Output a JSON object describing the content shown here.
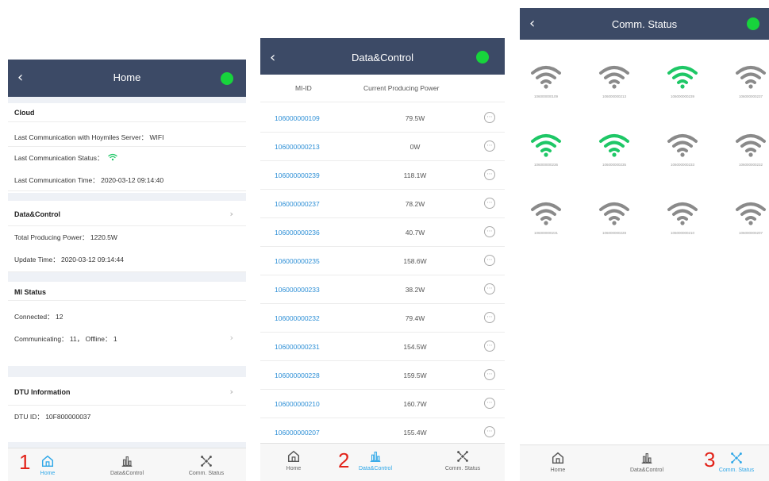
{
  "colors": {
    "navbar": "#3c4a66",
    "status_dot": "#17d43c",
    "link": "#2d8fd6",
    "active_tab": "#2ea7e8",
    "wifi_on": "#1ec766",
    "wifi_off": "#8a8a8a",
    "annotation": "#e2231a"
  },
  "tabs": [
    {
      "label": "Home",
      "icon": "home-icon"
    },
    {
      "label": "Data&Control",
      "icon": "bar-chart-icon"
    },
    {
      "label": "Comm. Status",
      "icon": "network-icon"
    }
  ],
  "home": {
    "title": "Home",
    "cloud": {
      "heading": "Cloud",
      "last_comm_server": "Last Communication with Hoymiles Server： WIFI",
      "last_comm_status": "Last Communication Status：",
      "last_comm_time": "Last Communication Time： 2020-03-12 09:14:40"
    },
    "data_control": {
      "heading": "Data&Control",
      "total_power": "Total Producing Power： 1220.5W",
      "update_time": "Update Time： 2020-03-12 09:14:44"
    },
    "mi_status": {
      "heading": "MI Status",
      "connected": "Connected： 12",
      "communicating": "Communicating： 11， Offline： 1"
    },
    "dtu": {
      "heading": "DTU Information",
      "dtu_id": "DTU ID： 10F800000037"
    },
    "annotation": "1"
  },
  "data_control": {
    "title": "Data&Control",
    "col_id": "MI-ID",
    "col_power": "Current Producing Power",
    "rows": [
      {
        "id": "106000000109",
        "power": "79.5W"
      },
      {
        "id": "106000000213",
        "power": "0W"
      },
      {
        "id": "106000000239",
        "power": "118.1W"
      },
      {
        "id": "106000000237",
        "power": "78.2W"
      },
      {
        "id": "106000000236",
        "power": "40.7W"
      },
      {
        "id": "106000000235",
        "power": "158.6W"
      },
      {
        "id": "106000000233",
        "power": "38.2W"
      },
      {
        "id": "106000000232",
        "power": "79.4W"
      },
      {
        "id": "106000000231",
        "power": "154.5W"
      },
      {
        "id": "106000000228",
        "power": "159.5W"
      },
      {
        "id": "106000000210",
        "power": "160.7W"
      },
      {
        "id": "106000000207",
        "power": "155.4W"
      }
    ],
    "annotation": "2"
  },
  "comm_status": {
    "title": "Comm. Status",
    "devices": [
      {
        "id": "106000000109",
        "online": false
      },
      {
        "id": "106000000213",
        "online": false
      },
      {
        "id": "106000000239",
        "online": true
      },
      {
        "id": "106000000237",
        "online": false
      },
      {
        "id": "106000000236",
        "online": true
      },
      {
        "id": "106000000235",
        "online": true
      },
      {
        "id": "106000000233",
        "online": false
      },
      {
        "id": "106000000232",
        "online": false
      },
      {
        "id": "106000000231",
        "online": false
      },
      {
        "id": "106000000228",
        "online": false
      },
      {
        "id": "106000000210",
        "online": false
      },
      {
        "id": "106000000207",
        "online": false
      }
    ],
    "annotation": "3"
  }
}
